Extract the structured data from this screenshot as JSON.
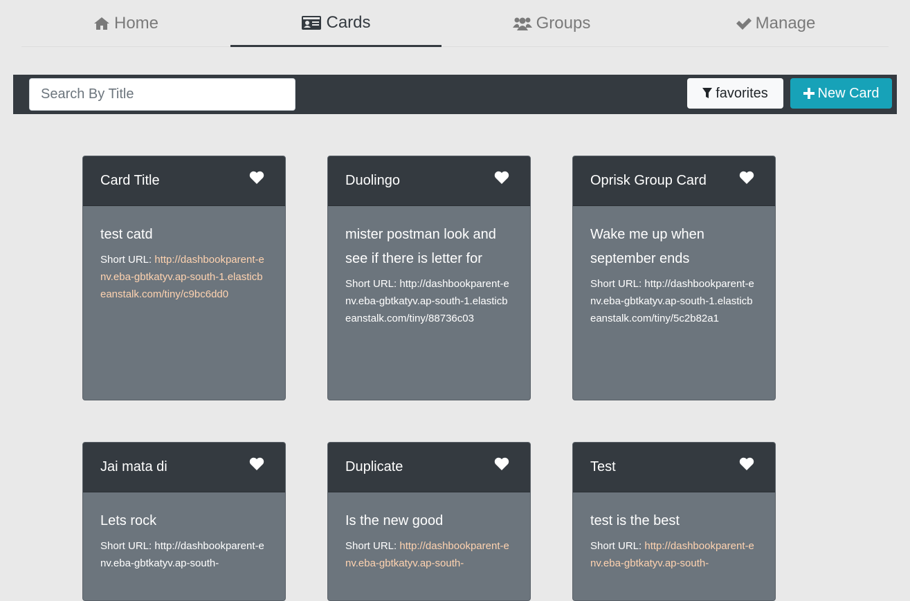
{
  "nav": {
    "tabs": [
      {
        "label": "Home"
      },
      {
        "label": "Cards"
      },
      {
        "label": "Groups"
      },
      {
        "label": "Manage"
      }
    ]
  },
  "toolbar": {
    "search_placeholder": "Search By Title",
    "favorites_label": "favorites",
    "new_card_label": "New Card"
  },
  "colors": {
    "dark": "#343a40",
    "card_body": "#6c757d",
    "accent": "#17a2b8",
    "link_highlight": "#ffd3b0"
  },
  "cards": [
    {
      "title": "Card Title",
      "text": "test catd",
      "short_label": "Short URL:",
      "url": "http://dashbookparent-env.eba-gbtkatyv.ap-south-1.elasticbeanstalk.com/tiny/c9bc6dd0"
    },
    {
      "title": "Duolingo",
      "text": "mister postman look and see if there is letter for",
      "short_label": "Short URL:",
      "url": "http://dashbookparent-env.eba-gbtkatyv.ap-south-1.elasticbeanstalk.com/tiny/88736c03"
    },
    {
      "title": "Oprisk Group Card",
      "text": "Wake me up when september ends",
      "short_label": "Short URL:",
      "url": "http://dashbookparent-env.eba-gbtkatyv.ap-south-1.elasticbeanstalk.com/tiny/5c2b82a1"
    },
    {
      "title": "Jai mata di",
      "text": "Lets rock",
      "short_label": "Short URL:",
      "url": "http://dashbookparent-env.eba-gbtkatyv.ap-south-"
    },
    {
      "title": "Duplicate",
      "text": "Is the new good",
      "short_label": "Short URL:",
      "url": "http://dashbookparent-env.eba-gbtkatyv.ap-south-"
    },
    {
      "title": "Test",
      "text": "test is the best",
      "short_label": "Short URL:",
      "url": "http://dashbookparent-env.eba-gbtkatyv.ap-south-"
    }
  ]
}
